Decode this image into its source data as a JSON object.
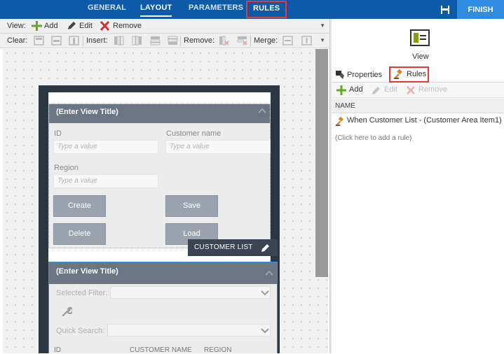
{
  "nav": {
    "tabs": [
      {
        "label": "GENERAL"
      },
      {
        "label": "LAYOUT"
      },
      {
        "label": "PARAMETERS"
      },
      {
        "label": "RULES"
      }
    ],
    "finish_label": "FINISH"
  },
  "toolbar": {
    "view_label": "View:",
    "add_label": "Add",
    "edit_label": "Edit",
    "remove_label": "Remove",
    "clear_label": "Clear:",
    "insert_label": "Insert:",
    "remove2_label": "Remove:",
    "merge_label": "Merge:"
  },
  "form_view": {
    "title": "(Enter View Title)",
    "fields": [
      {
        "label": "ID",
        "placeholder": "Type a value"
      },
      {
        "label": "Customer name",
        "placeholder": "Type a value"
      },
      {
        "label": "Region",
        "placeholder": "Type a value"
      }
    ],
    "buttons": [
      "Create",
      "Save",
      "Delete",
      "Load"
    ]
  },
  "list_view": {
    "title": "(Enter View Title)",
    "tag_label": "CUSTOMER LIST",
    "selected_filter_label": "Selected Filter:",
    "quick_search_label": "Quick Search:",
    "columns": [
      "ID",
      "CUSTOMER NAME",
      "REGION"
    ]
  },
  "panel": {
    "view_label": "View",
    "properties_tab": "Properties",
    "rules_tab": "Rules",
    "add_label": "Add",
    "edit_label": "Edit",
    "remove_label": "Remove",
    "name_header": "NAME",
    "rule_text": "When Customer List - (Customer Area Item1)...",
    "add_rule_hint": "(Click here to add a rule)"
  },
  "colors": {
    "nav_bg": "#0d5ba8",
    "finish_bg": "#2f8ce0",
    "highlight": "#e53935",
    "view_header": "#6b7584",
    "button_bg": "#9aa3ae"
  }
}
